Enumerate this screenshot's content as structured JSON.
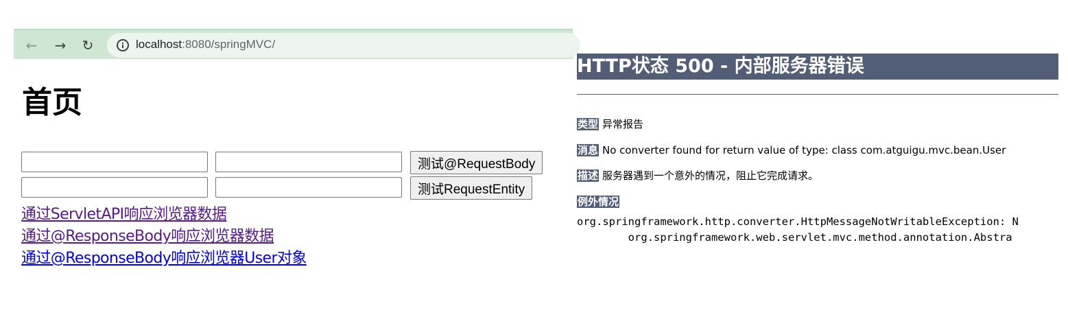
{
  "browser": {
    "url_host": "localhost",
    "url_rest": ":8080/springMVC/",
    "back_glyph": "←",
    "forward_glyph": "→",
    "reload_glyph": "↻"
  },
  "page": {
    "title": "首页",
    "forms": [
      {
        "field1_value": "",
        "field2_value": "",
        "submit_label": "测试@RequestBody"
      },
      {
        "field1_value": "",
        "field2_value": "",
        "submit_label": "测试RequestEntity"
      }
    ],
    "links": [
      {
        "label": "通过ServletAPI响应浏览器数据",
        "state": "visited"
      },
      {
        "label": "通过@ResponseBody响应浏览器数据",
        "state": "visited"
      },
      {
        "label": "通过@ResponseBody响应浏览器User对象",
        "state": "unvisited"
      }
    ]
  },
  "error_page": {
    "title": "HTTP状态 500 - 内部服务器错误",
    "type_label": "类型",
    "type_value": "异常报告",
    "message_label": "消息",
    "message_value": "No converter found for return value of type: class com.atguigu.mvc.bean.User",
    "description_label": "描述",
    "description_value": "服务器遇到一个意外的情况，阻止它完成请求。",
    "exception_label": "例外情况",
    "stack_line1": "org.springframework.http.converter.HttpMessageNotWritableException: N",
    "stack_line2": "\torg.springframework.web.servlet.mvc.method.annotation.Abstra"
  },
  "colors": {
    "toolbar_bg": "#cfe6d2",
    "error_accent": "#525d76",
    "link_visited": "#551a8b",
    "link_unvisited": "#0000ee"
  }
}
